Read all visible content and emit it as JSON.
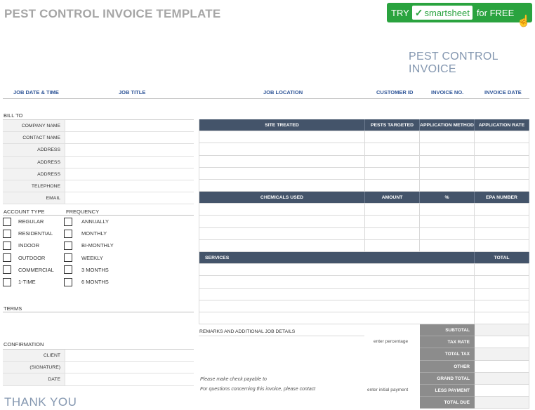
{
  "title": "PEST CONTROL INVOICE TEMPLATE",
  "promo": {
    "try": "TRY",
    "brand": "smartsheet",
    "suffix": "for FREE"
  },
  "invoice_title": "PEST CONTROL INVOICE",
  "header_columns": [
    "JOB DATE & TIME",
    "JOB TITLE",
    "JOB LOCATION",
    "CUSTOMER ID",
    "INVOICE NO.",
    "INVOICE DATE"
  ],
  "bill_to": {
    "label": "BILL TO",
    "rows": [
      "COMPANY NAME",
      "CONTACT NAME",
      "ADDRESS",
      "ADDRESS",
      "ADDRESS",
      "TELEPHONE",
      "EMAIL"
    ]
  },
  "account_type": {
    "label": "ACCOUNT TYPE",
    "options": [
      "REGULAR",
      "RESIDENTIAL",
      "INDOOR",
      "OUTDOOR",
      "COMMERCIAL",
      "1-TIME"
    ]
  },
  "frequency": {
    "label": "FREQUENCY",
    "options": [
      "ANNUALLY",
      "MONTHLY",
      "BI-MONTHLY",
      "WEEKLY",
      "3 MONTHS",
      "6 MONTHS"
    ]
  },
  "terms_label": "TERMS",
  "confirmation": {
    "label": "CONFIRMATION",
    "rows": [
      "CLIENT",
      "(SIGNATURE)",
      "DATE"
    ]
  },
  "thank_you": "THANK YOU",
  "site_table": {
    "headers": [
      "SITE TREATED",
      "PESTS TARGETED",
      "APPLICATION METHOD",
      "APPLICATION RATE"
    ]
  },
  "chemicals_table": {
    "headers": [
      "CHEMICALS USED",
      "AMOUNT",
      "%",
      "EPA NUMBER"
    ]
  },
  "services_table": {
    "headers": [
      "SERVICES",
      "TOTAL"
    ]
  },
  "remarks_label": "REMARKS AND ADDITIONAL JOB DETAILS",
  "enter_percentage": "enter percentage",
  "enter_initial_payment": "enter initial payment",
  "payable_note": "Please make check payable to",
  "questions_note": "For questions concerning this invoice, please contact",
  "totals": [
    "SUBTOTAL",
    "TAX RATE",
    "TOTAL TAX",
    "OTHER",
    "GRAND TOTAL",
    "LESS PAYMENT",
    "TOTAL DUE"
  ]
}
